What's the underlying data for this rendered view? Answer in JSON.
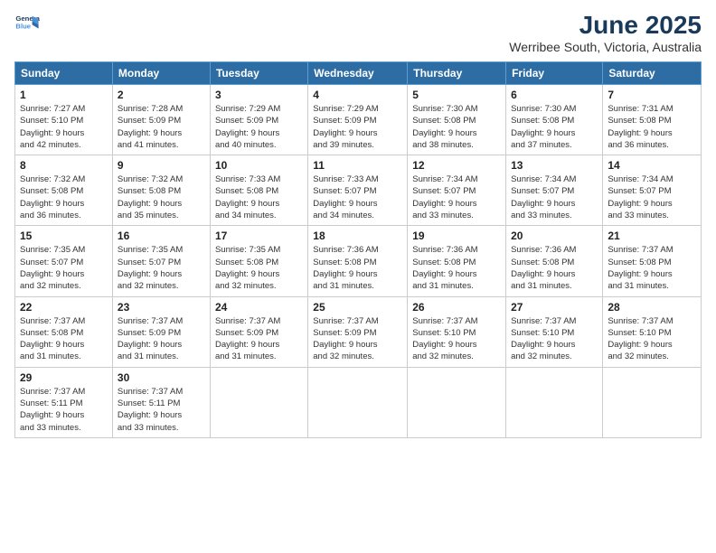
{
  "logo": {
    "line1": "General",
    "line2": "Blue"
  },
  "title": "June 2025",
  "location": "Werribee South, Victoria, Australia",
  "headers": [
    "Sunday",
    "Monday",
    "Tuesday",
    "Wednesday",
    "Thursday",
    "Friday",
    "Saturday"
  ],
  "weeks": [
    [
      {
        "day": "1",
        "info": "Sunrise: 7:27 AM\nSunset: 5:10 PM\nDaylight: 9 hours\nand 42 minutes."
      },
      {
        "day": "2",
        "info": "Sunrise: 7:28 AM\nSunset: 5:09 PM\nDaylight: 9 hours\nand 41 minutes."
      },
      {
        "day": "3",
        "info": "Sunrise: 7:29 AM\nSunset: 5:09 PM\nDaylight: 9 hours\nand 40 minutes."
      },
      {
        "day": "4",
        "info": "Sunrise: 7:29 AM\nSunset: 5:09 PM\nDaylight: 9 hours\nand 39 minutes."
      },
      {
        "day": "5",
        "info": "Sunrise: 7:30 AM\nSunset: 5:08 PM\nDaylight: 9 hours\nand 38 minutes."
      },
      {
        "day": "6",
        "info": "Sunrise: 7:30 AM\nSunset: 5:08 PM\nDaylight: 9 hours\nand 37 minutes."
      },
      {
        "day": "7",
        "info": "Sunrise: 7:31 AM\nSunset: 5:08 PM\nDaylight: 9 hours\nand 36 minutes."
      }
    ],
    [
      {
        "day": "8",
        "info": "Sunrise: 7:32 AM\nSunset: 5:08 PM\nDaylight: 9 hours\nand 36 minutes."
      },
      {
        "day": "9",
        "info": "Sunrise: 7:32 AM\nSunset: 5:08 PM\nDaylight: 9 hours\nand 35 minutes."
      },
      {
        "day": "10",
        "info": "Sunrise: 7:33 AM\nSunset: 5:08 PM\nDaylight: 9 hours\nand 34 minutes."
      },
      {
        "day": "11",
        "info": "Sunrise: 7:33 AM\nSunset: 5:07 PM\nDaylight: 9 hours\nand 34 minutes."
      },
      {
        "day": "12",
        "info": "Sunrise: 7:34 AM\nSunset: 5:07 PM\nDaylight: 9 hours\nand 33 minutes."
      },
      {
        "day": "13",
        "info": "Sunrise: 7:34 AM\nSunset: 5:07 PM\nDaylight: 9 hours\nand 33 minutes."
      },
      {
        "day": "14",
        "info": "Sunrise: 7:34 AM\nSunset: 5:07 PM\nDaylight: 9 hours\nand 33 minutes."
      }
    ],
    [
      {
        "day": "15",
        "info": "Sunrise: 7:35 AM\nSunset: 5:07 PM\nDaylight: 9 hours\nand 32 minutes."
      },
      {
        "day": "16",
        "info": "Sunrise: 7:35 AM\nSunset: 5:07 PM\nDaylight: 9 hours\nand 32 minutes."
      },
      {
        "day": "17",
        "info": "Sunrise: 7:35 AM\nSunset: 5:08 PM\nDaylight: 9 hours\nand 32 minutes."
      },
      {
        "day": "18",
        "info": "Sunrise: 7:36 AM\nSunset: 5:08 PM\nDaylight: 9 hours\nand 31 minutes."
      },
      {
        "day": "19",
        "info": "Sunrise: 7:36 AM\nSunset: 5:08 PM\nDaylight: 9 hours\nand 31 minutes."
      },
      {
        "day": "20",
        "info": "Sunrise: 7:36 AM\nSunset: 5:08 PM\nDaylight: 9 hours\nand 31 minutes."
      },
      {
        "day": "21",
        "info": "Sunrise: 7:37 AM\nSunset: 5:08 PM\nDaylight: 9 hours\nand 31 minutes."
      }
    ],
    [
      {
        "day": "22",
        "info": "Sunrise: 7:37 AM\nSunset: 5:08 PM\nDaylight: 9 hours\nand 31 minutes."
      },
      {
        "day": "23",
        "info": "Sunrise: 7:37 AM\nSunset: 5:09 PM\nDaylight: 9 hours\nand 31 minutes."
      },
      {
        "day": "24",
        "info": "Sunrise: 7:37 AM\nSunset: 5:09 PM\nDaylight: 9 hours\nand 31 minutes."
      },
      {
        "day": "25",
        "info": "Sunrise: 7:37 AM\nSunset: 5:09 PM\nDaylight: 9 hours\nand 32 minutes."
      },
      {
        "day": "26",
        "info": "Sunrise: 7:37 AM\nSunset: 5:10 PM\nDaylight: 9 hours\nand 32 minutes."
      },
      {
        "day": "27",
        "info": "Sunrise: 7:37 AM\nSunset: 5:10 PM\nDaylight: 9 hours\nand 32 minutes."
      },
      {
        "day": "28",
        "info": "Sunrise: 7:37 AM\nSunset: 5:10 PM\nDaylight: 9 hours\nand 32 minutes."
      }
    ],
    [
      {
        "day": "29",
        "info": "Sunrise: 7:37 AM\nSunset: 5:11 PM\nDaylight: 9 hours\nand 33 minutes."
      },
      {
        "day": "30",
        "info": "Sunrise: 7:37 AM\nSunset: 5:11 PM\nDaylight: 9 hours\nand 33 minutes."
      },
      {
        "day": "",
        "info": ""
      },
      {
        "day": "",
        "info": ""
      },
      {
        "day": "",
        "info": ""
      },
      {
        "day": "",
        "info": ""
      },
      {
        "day": "",
        "info": ""
      }
    ]
  ]
}
